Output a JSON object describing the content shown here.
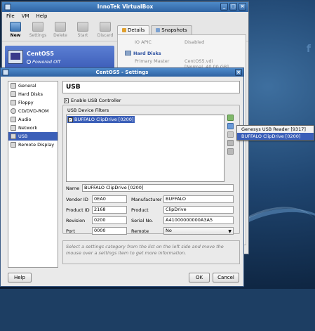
{
  "main_window": {
    "title": "InnoTek VirtualBox",
    "menu": [
      "File",
      "VM",
      "Help"
    ],
    "toolbar": [
      "New",
      "Settings",
      "Delete",
      "Start",
      "Discard"
    ],
    "vm": {
      "name": "CentOS5",
      "state": "Powered Off",
      "icon": "centos-os-icon"
    },
    "tabs": [
      "Details",
      "Snapshots"
    ],
    "details": {
      "io_apic_label": "IO APIC",
      "io_apic_value": "Disabled",
      "hard_disks_heading": "Hard Disks",
      "primary_master_label": "Primary Master",
      "primary_master_value": "CentOS5.vdi",
      "primary_master_extra": "[Normal, 40,00 GB]"
    }
  },
  "dialog": {
    "title": "CentOS5 - Settings",
    "categories": [
      "General",
      "Hard Disks",
      "Floppy",
      "CD/DVD-ROM",
      "Audio",
      "Network",
      "USB",
      "Remote Display"
    ],
    "selected_category": "USB",
    "page_title": "USB",
    "enable_usb_label": "Enable USB Controller",
    "enable_usb_checked": true,
    "filters_group_label": "USB Device Filters",
    "filters": [
      {
        "label": "BUFFALO ClipDrive [0200]",
        "checked": true
      }
    ],
    "form": {
      "name_label": "Name",
      "name_value": "BUFFALO ClipDrive [0200]",
      "vendor_label": "Vendor ID",
      "vendor_value": "0EA0",
      "manufacturer_label": "Manufacturer",
      "manufacturer_value": "BUFFALO",
      "product_id_label": "Product ID",
      "product_id_value": "2168",
      "product_label": "Product",
      "product_value": "ClipDrive",
      "revision_label": "Revision",
      "revision_value": "0200",
      "serial_label": "Serial No.",
      "serial_value": "A41000000000A3A5",
      "port_label": "Port",
      "port_value": "0000",
      "remote_label": "Remote",
      "remote_value": "No"
    },
    "hint": "Select a settings category from the list on the left side and move the mouse over a settings item to get more information.",
    "buttons": {
      "help": "Help",
      "ok": "OK",
      "cancel": "Cancel"
    }
  },
  "popup_menu": {
    "items": [
      "Genesys USB Reader [9317]",
      "BUFFALO ClipDrive [0200]"
    ],
    "selected_index": 1
  }
}
